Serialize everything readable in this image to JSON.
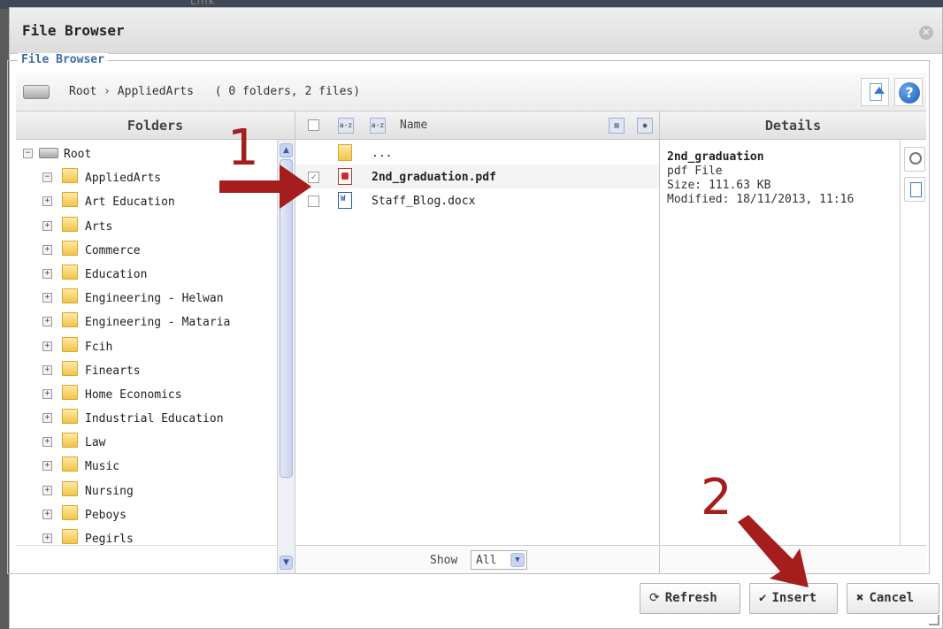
{
  "background": {
    "ghost_text": "Link"
  },
  "dialog": {
    "title": "File Browser"
  },
  "fieldset": {
    "legend": "File Browser"
  },
  "pathbar": {
    "root": "Root",
    "separator": "›",
    "current": "AppliedArts",
    "counts": "( 0 folders, 2 files)"
  },
  "folders": {
    "header": "Folders",
    "root": "Root",
    "items": [
      {
        "label": "AppliedArts",
        "expanded": true
      },
      {
        "label": "Art Education"
      },
      {
        "label": "Arts"
      },
      {
        "label": "Commerce"
      },
      {
        "label": "Education"
      },
      {
        "label": "Engineering - Helwan"
      },
      {
        "label": "Engineering - Mataria"
      },
      {
        "label": "Fcih"
      },
      {
        "label": "Finearts"
      },
      {
        "label": "Home Economics"
      },
      {
        "label": "Industrial Education"
      },
      {
        "label": "Law"
      },
      {
        "label": "Music"
      },
      {
        "label": "Nursing"
      },
      {
        "label": "Peboys"
      },
      {
        "label": "Pegirls"
      }
    ]
  },
  "files": {
    "name_header": "Name",
    "sort_icons": [
      "az-sort-icon",
      "az-sort-desc-icon"
    ],
    "rows": [
      {
        "name": "...",
        "type": "up"
      },
      {
        "name": "2nd_graduation.pdf",
        "type": "pdf",
        "checked": true,
        "selected": true
      },
      {
        "name": "Staff_Blog.docx",
        "type": "doc",
        "checked": false
      }
    ],
    "show_label": "Show",
    "show_value": "All"
  },
  "details": {
    "header": "Details",
    "name": "2nd_graduation",
    "type": "pdf File",
    "size": "Size: 111.63 KB",
    "modified": "Modified: 18/11/2013, 11:16"
  },
  "actions": {
    "refresh": "Refresh",
    "insert": "Insert",
    "cancel": "Cancel"
  },
  "annotations": {
    "step1": "1",
    "step2": "2"
  },
  "colors": {
    "legend": "#3a6fa8",
    "annotation": "#a51d1d",
    "help_blue": "#1a5fb4"
  }
}
